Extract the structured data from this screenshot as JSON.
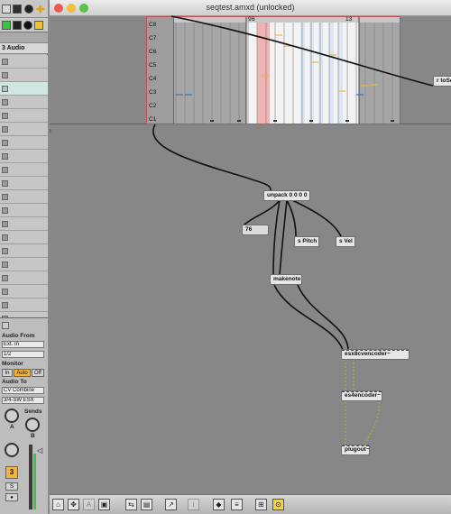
{
  "window": {
    "title": "seqtest.amxd (unlocked)"
  },
  "left_panel": {
    "track_name": "3 Audio",
    "track_rows": 20,
    "selected_row": 2,
    "audio_from_label": "Audio From",
    "audio_from_value": "Ext. In",
    "channel_value": "1/2",
    "monitor_label": "Monitor",
    "monitor_in": "In",
    "monitor_auto": "Auto",
    "monitor_off": "Off",
    "audio_to_label": "Audio To",
    "audio_to_value": "CV Combine",
    "audio_to_sub": "3/4-SW ESX",
    "sends_label": "Sends",
    "send_a": "A",
    "send_b": "B",
    "track_number": "3",
    "solo": "S",
    "arm": "●"
  },
  "sequencer": {
    "note_labels": [
      "C8",
      "C7",
      "C6",
      "C5",
      "C4",
      "C3",
      "C2",
      "C1"
    ],
    "ruler_start": "9",
    "ruler_mid": "6",
    "ruler_end": "13"
  },
  "objects": {
    "unpack": "unpack 0 0 0 0",
    "number": "76",
    "s_pitch": "s Pitch",
    "s_vel": "s Vel",
    "makenote": "makenote",
    "esx8cvencoder": "esx8cvencoder~",
    "es4encoder": "es4encoder~",
    "plugout": "plugout~",
    "r_toseq": "r toSe"
  },
  "colors": {
    "close": "#ec5a52",
    "minimize": "#f0be3a",
    "zoom": "#5cc245",
    "accent": "#f2b43a",
    "selected_row": "#cfe7e3",
    "seq_border": "#c05050"
  },
  "bottom_toolbar": {
    "icons": [
      "lock-icon",
      "grid-icon",
      "text-icon",
      "presentation-icon",
      "patchcord-icon",
      "new-object-icon",
      "info-icon",
      "inspector-icon",
      "align-icon",
      "hierarchy-icon",
      "zoom-icon"
    ]
  }
}
